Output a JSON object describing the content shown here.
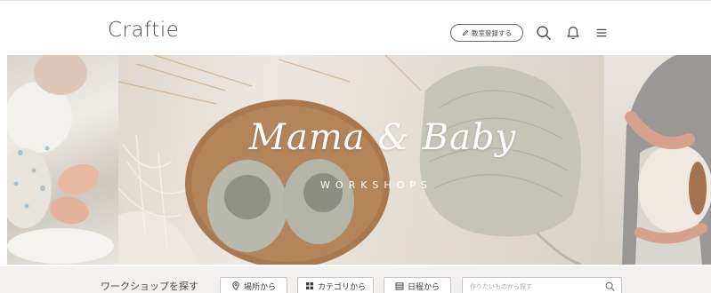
{
  "header": {
    "logo": "Craftie",
    "register_button": "教室登録する",
    "icons": [
      "search-icon",
      "bell-icon",
      "menu-icon"
    ]
  },
  "hero": {
    "title": "Mama & Baby",
    "subtitle": "WORKSHOPS"
  },
  "search": {
    "label": "ワークショップを探す",
    "filters": [
      {
        "label": "場所から",
        "icon": "location-pin-icon"
      },
      {
        "label": "カテゴリから",
        "icon": "grid-icon"
      },
      {
        "label": "日程から",
        "icon": "calendar-icon"
      }
    ],
    "placeholder": "作りたいものから探す"
  },
  "colors": {
    "text": "#4a4545",
    "border": "#c9c4c1",
    "search_bg": "#f3f1f0"
  }
}
